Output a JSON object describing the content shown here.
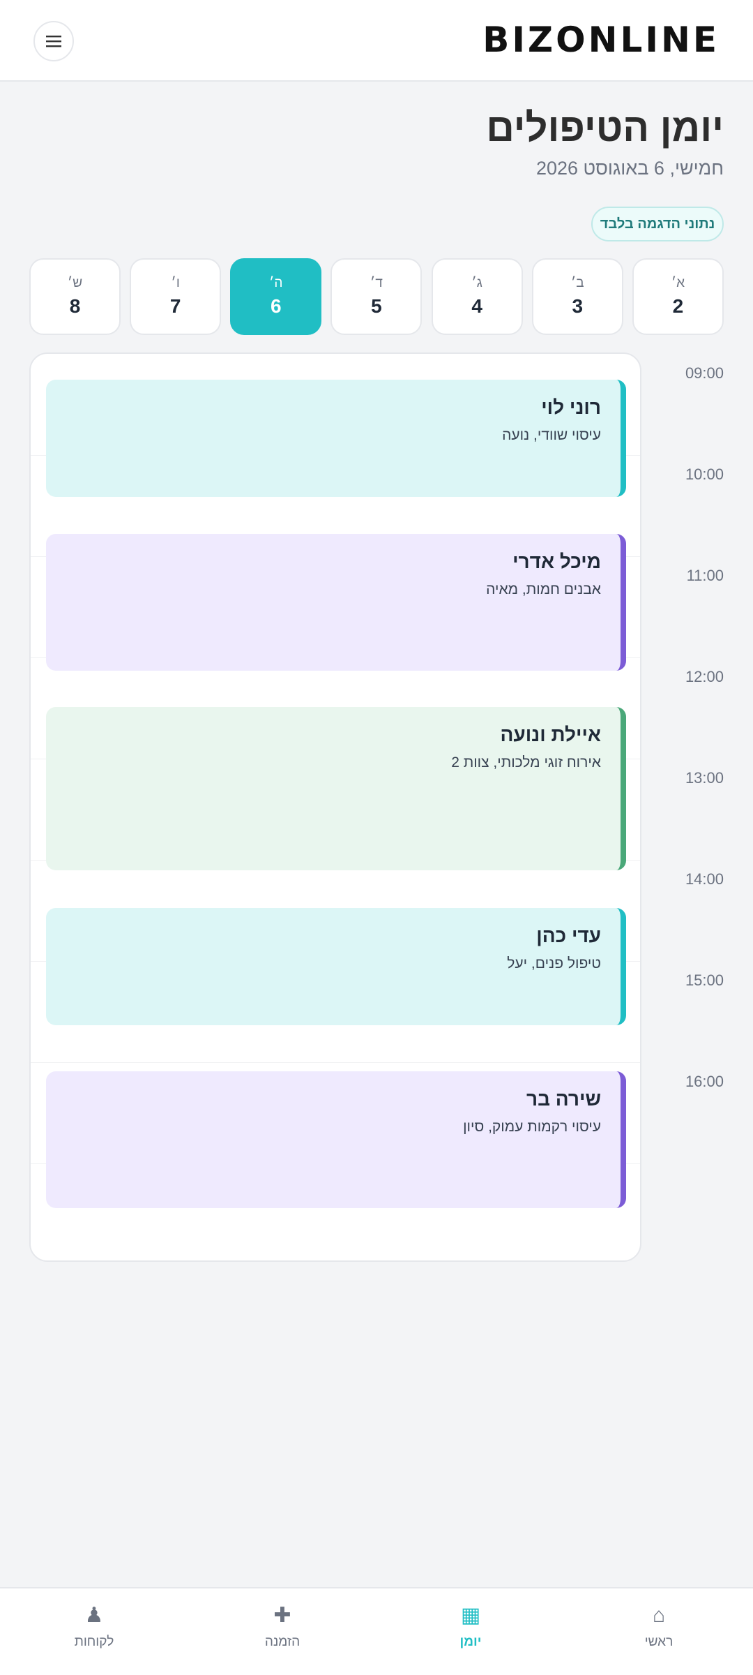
{
  "header": {
    "brand": "BIZONLINE",
    "menu_icon": "menu-icon"
  },
  "page": {
    "title": "יומן הטיפולים",
    "subtitle": "חמישי, 6 באוגוסט 2026",
    "demo_badge": "נתוני הדגמה בלבד"
  },
  "days": [
    {
      "name": "א׳",
      "num": "2"
    },
    {
      "name": "ב׳",
      "num": "3"
    },
    {
      "name": "ג׳",
      "num": "4"
    },
    {
      "name": "ד׳",
      "num": "5"
    },
    {
      "name": "ה׳",
      "num": "6"
    },
    {
      "name": "ו׳",
      "num": "7"
    },
    {
      "name": "ש׳",
      "num": "8"
    }
  ],
  "times": [
    "09:00",
    "10:00",
    "11:00",
    "12:00",
    "13:00",
    "14:00",
    "15:00",
    "16:00"
  ],
  "appointments": [
    {
      "name": "רוני לוי",
      "detail": "עיסוי שוודי, נועה",
      "theme": "teal"
    },
    {
      "name": "מיכל אדרי",
      "detail": "אבנים חמות, מאיה",
      "theme": "purple"
    },
    {
      "name": "איילת ונועה",
      "detail": "אירוח זוגי מלכותי, צוות 2",
      "theme": "green"
    },
    {
      "name": "עדי כהן",
      "detail": "טיפול פנים, יעל",
      "theme": "teal"
    },
    {
      "name": "שירה בר",
      "detail": "עיסוי רקמות עמוק, סיון",
      "theme": "purple"
    }
  ],
  "nav": [
    {
      "label": "ראשי",
      "icon": "home-icon",
      "glyph": "⌂"
    },
    {
      "label": "יומן",
      "icon": "calendar-icon",
      "glyph": "▦"
    },
    {
      "label": "הזמנה",
      "icon": "plus-icon",
      "glyph": "✚"
    },
    {
      "label": "לקוחות",
      "icon": "user-icon",
      "glyph": "♟"
    }
  ],
  "colors": {
    "accent": "#20bec4",
    "teal_card": "#dcf6f6",
    "purple_card": "#efeafe",
    "green_card": "#e9f6ee"
  }
}
